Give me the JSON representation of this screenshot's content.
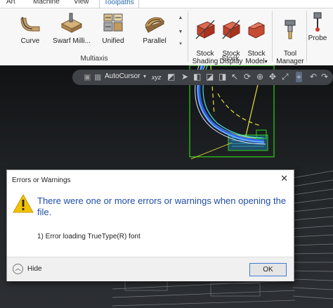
{
  "ribbon": {
    "tabs": [
      {
        "label": "Art"
      },
      {
        "label": "Machine"
      },
      {
        "label": "View"
      },
      {
        "label": "Toolpaths"
      }
    ],
    "multiaxis": {
      "group_label": "Multiaxis",
      "buttons": [
        {
          "label": "Curve"
        },
        {
          "label": "Swarf Milli..."
        },
        {
          "label": "Unified"
        },
        {
          "label": "Parallel"
        }
      ]
    },
    "stock": {
      "group_label": "Stock",
      "shading_label": "Stock\nShading",
      "display_label": "Stock\nDisplay",
      "model_label": "Stock\nModel",
      "model_dropdown": "▾"
    },
    "tool_manager_label": "Tool\nManager",
    "probe_label": "Probe"
  },
  "viewport": {
    "autocursor_label": "AutoCursor",
    "axis_label": "xyz"
  },
  "dialog": {
    "title": "Errors or Warnings",
    "close": "✕",
    "message": "There were one or more errors or warnings when opening the file.",
    "detail": "1) Error loading TrueType(R) font",
    "hide_label": "Hide",
    "ok_label": "OK"
  },
  "colors": {
    "accent_blue": "#1f4ea8",
    "warning_yellow": "#f2c200",
    "toolpath_green": "#2fd11a",
    "toolpath_yellow": "#e8e13a"
  }
}
